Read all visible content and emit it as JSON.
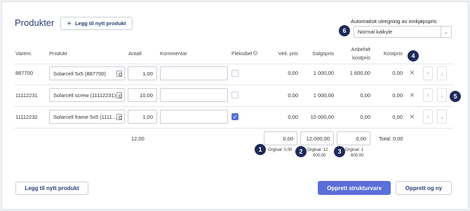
{
  "page": {
    "title": "Produkter",
    "add_product_top": "Legg til nytt produkt",
    "add_icon": "+"
  },
  "auto_calc": {
    "label": "Automatisk utregning av innkjøpspris",
    "selected": "Normal kalkyle"
  },
  "columns": {
    "varenr": "Varenr.",
    "produkt": "Produkt",
    "antall": "Antall",
    "kommentar": "Kommentar",
    "fleksibel": "Fleksibel",
    "veil_pris": "Veil. pris",
    "salgspris": "Salgspris",
    "anbefalt_kostpris_1": "Anbefalt",
    "anbefalt_kostpris_2": "kostpris",
    "kostpris": "Kostpris"
  },
  "rows": [
    {
      "varenr": "887700",
      "produkt": "Solarcell 5x5 (887700)",
      "antall": "1,00",
      "kommentar": "",
      "fleksibel": false,
      "veil_pris": "0,00",
      "salgspris": "1 000,00",
      "anbefalt": "1 600,00",
      "kostpris": "0,00"
    },
    {
      "varenr": "11112231",
      "produkt": "Solarcell screw (11112231)",
      "antall": "10,00",
      "kommentar": "",
      "fleksibel": false,
      "veil_pris": "0,00",
      "salgspris": "1 000,00",
      "anbefalt": "0,00",
      "kostpris": "0,00"
    },
    {
      "varenr": "11112232",
      "produkt": "Solarcell frame 5x5 (1111...",
      "antall": "1,00",
      "kommentar": "",
      "fleksibel": true,
      "veil_pris": "0,00",
      "salgspris": "10 000,00",
      "anbefalt": "0,00",
      "kostpris": "0,00"
    }
  ],
  "totals": {
    "antall": "12,00",
    "veil_pris": "0,00",
    "salgspris": "12,000,00",
    "kostpris": "0,00",
    "total_label": "Total: 0,00"
  },
  "originals": {
    "veil_1": "Orginal: 0,00",
    "salg_1": "Orginal: 12",
    "salg_2": "000,00",
    "kost_1": "Orginal: 1",
    "kost_2": "600,00"
  },
  "badges": [
    "1",
    "2",
    "3",
    "4",
    "5",
    "6"
  ],
  "footer": {
    "add_product": "Legg til nytt produkt",
    "create_structure": "Opprett strukturvare",
    "create_new": "Opprett og ny"
  },
  "icons": {
    "remove": "×",
    "up": "↑",
    "down": "↓",
    "chevron": "⌄",
    "check": "✓",
    "info": "?"
  },
  "colors": {
    "primary": "#5b6fd8",
    "title": "#2c3e75",
    "badge": "#1e2a5a"
  }
}
